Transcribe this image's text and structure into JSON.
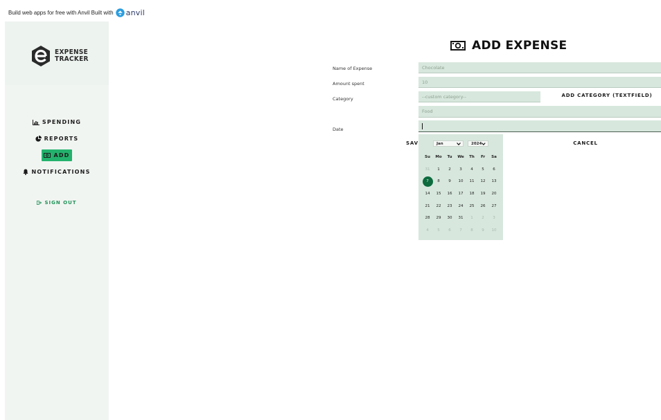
{
  "banner": {
    "text": "Build web apps for free with Anvil Built with",
    "brand": "anvil"
  },
  "logo": {
    "line1": "EXPENSE",
    "line2": "TRACKER"
  },
  "nav": {
    "spending": "SPENDING",
    "reports": "REPORTS",
    "add": "ADD",
    "notifications": "NOTIFICATIONS",
    "sign_out": "SIGN OUT"
  },
  "page": {
    "title": "ADD EXPENSE"
  },
  "form": {
    "name_label": "Name of Expense",
    "name_value": "Chocolate",
    "amount_label": "Amount spent",
    "amount_value": "10",
    "category_label": "Category",
    "custom_category_placeholder": "--custom category--",
    "add_category_label": "ADD CATEGORY (TEXTFIELD)",
    "category_value": "Food",
    "date_label": "Date",
    "date_value": "",
    "save_label": "SAV",
    "cancel_label": "CANCEL"
  },
  "calendar": {
    "month": "Jan",
    "year": "2024",
    "weekdays": [
      "Su",
      "Mo",
      "Tu",
      "We",
      "Th",
      "Fr",
      "Sa"
    ],
    "weeks": [
      [
        "31",
        "1",
        "2",
        "3",
        "4",
        "5",
        "6"
      ],
      [
        "7",
        "8",
        "9",
        "10",
        "11",
        "12",
        "13"
      ],
      [
        "14",
        "15",
        "16",
        "17",
        "18",
        "19",
        "20"
      ],
      [
        "21",
        "22",
        "23",
        "24",
        "25",
        "26",
        "27"
      ],
      [
        "28",
        "29",
        "30",
        "31",
        "1",
        "2",
        "3"
      ],
      [
        "4",
        "5",
        "6",
        "7",
        "8",
        "9",
        "10"
      ]
    ],
    "selected_day": "7"
  },
  "colors": {
    "accent": "#23b26d",
    "accent_dark": "#0d6b3e",
    "field_bg": "#d7e7dd",
    "sidebar_bg": "#f1f5f2"
  },
  "icons": {
    "spending": "bar-chart-icon",
    "reports": "pie-chart-icon",
    "add": "money-bill-icon",
    "notifications": "bell-icon",
    "sign_out": "sign-out-icon",
    "title": "money-bill-icon"
  }
}
